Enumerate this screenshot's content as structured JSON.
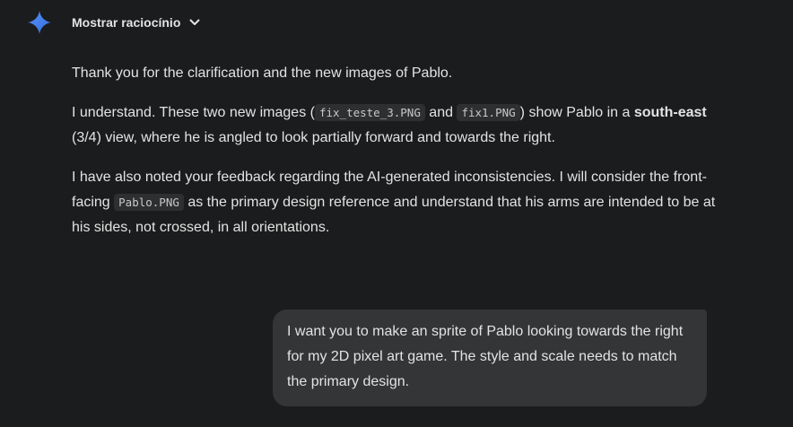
{
  "reasoning": {
    "label": "Mostrar raciocínio"
  },
  "icons": {
    "assistant": "gemini-sparkle-icon",
    "toggle": "chevron-down-icon"
  },
  "colors": {
    "background": "#1b1c1d",
    "text": "#e3e3e3",
    "code_bg": "#2e2f31",
    "user_bubble_bg": "#333537",
    "sparkle_blue": "#4a8cf7"
  },
  "response": {
    "p1": "Thank you for the clarification and the new images of Pablo.",
    "p2": {
      "before": "I understand. These two new images (",
      "code1": "fix_teste_3.PNG",
      "mid": " and ",
      "code2": "fix1.PNG",
      "after": ") show Pablo in a ",
      "bold": "south-east",
      "end": " (3/4) view, where he is angled to look partially forward and towards the right."
    },
    "p3": {
      "before": "I have also noted your feedback regarding the AI-generated inconsistencies. I will consider the front-facing ",
      "code": "Pablo.PNG",
      "after": " as the primary design reference and understand that his arms are intended to be at his sides, not crossed, in all orientations."
    }
  },
  "user_message": {
    "text": "I want you to make an sprite of Pablo looking towards the right for my 2D pixel art game. The style and scale needs to match the primary design."
  }
}
